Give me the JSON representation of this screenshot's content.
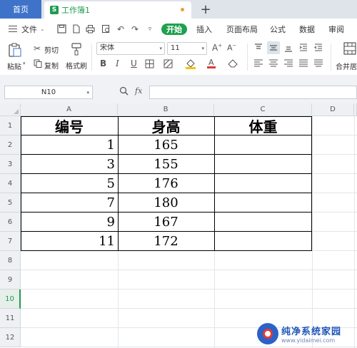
{
  "tabs": {
    "home": "首页",
    "document": "工作簿1",
    "add": "+"
  },
  "menu": {
    "file": "文件",
    "items": [
      "开始",
      "插入",
      "页面布局",
      "公式",
      "数据",
      "审阅"
    ]
  },
  "ribbon": {
    "paste": "粘贴",
    "cut": "剪切",
    "copy": "复制",
    "format_painter": "格式刷",
    "font_name": "宋体",
    "font_size": "11",
    "merge_center": "合并居"
  },
  "formula_bar": {
    "cell_ref": "N10",
    "fx_label": "fx",
    "formula": ""
  },
  "columns": [
    "A",
    "B",
    "C",
    "D"
  ],
  "rows": [
    "1",
    "2",
    "3",
    "4",
    "5",
    "6",
    "7",
    "8",
    "9",
    "10",
    "11",
    "12"
  ],
  "table": {
    "headers": [
      "编号",
      "身高",
      "体重"
    ],
    "rows": [
      [
        "1",
        "165",
        ""
      ],
      [
        "3",
        "155",
        ""
      ],
      [
        "5",
        "176",
        ""
      ],
      [
        "7",
        "180",
        ""
      ],
      [
        "9",
        "167",
        ""
      ],
      [
        "11",
        "172",
        ""
      ]
    ]
  },
  "watermark": {
    "title": "纯净系统家园",
    "url": "www.yidaimei.com"
  }
}
